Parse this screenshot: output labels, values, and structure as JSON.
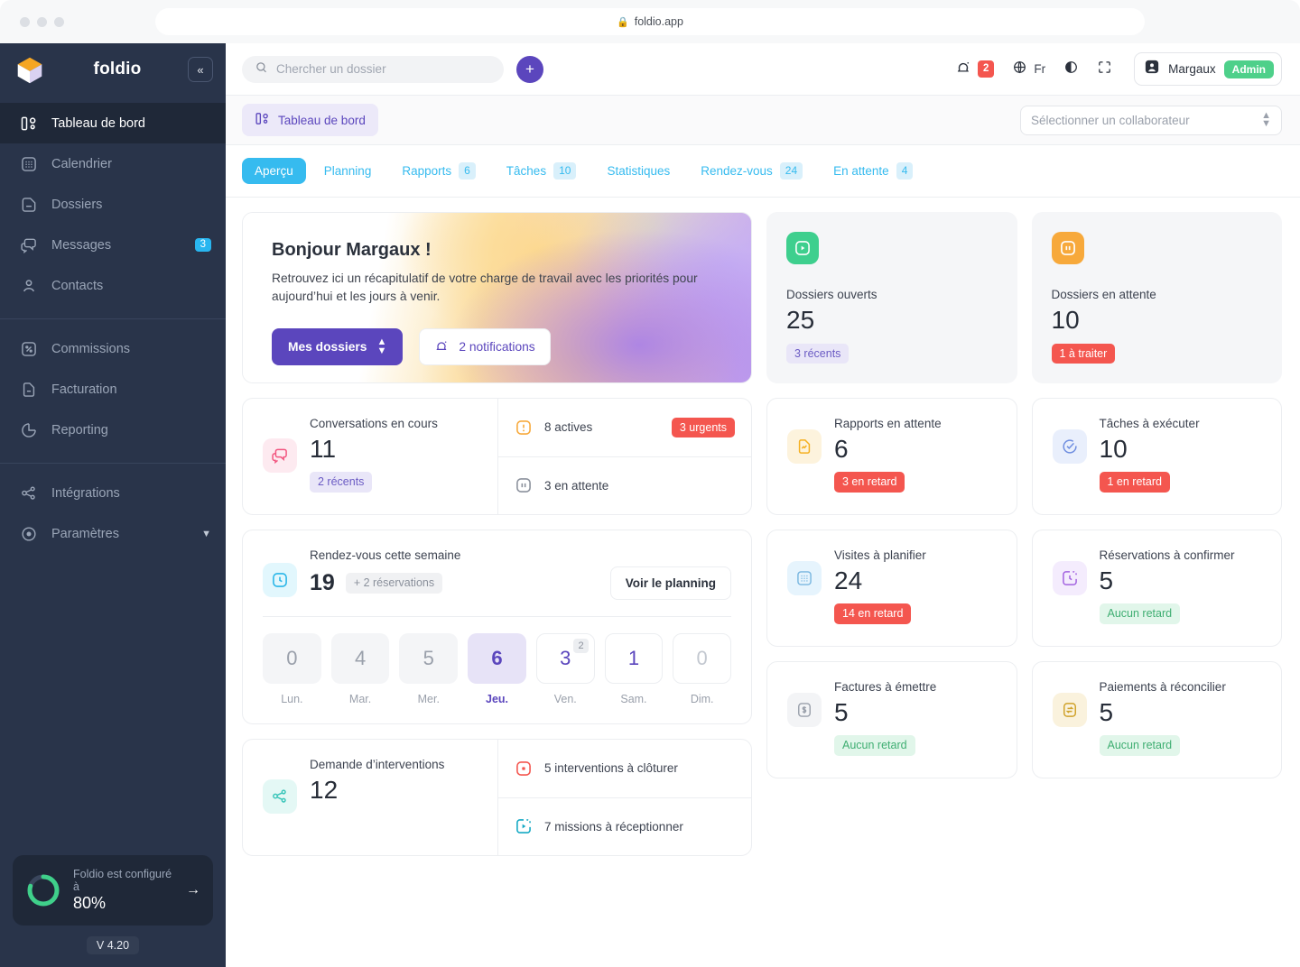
{
  "browser": {
    "url": "foldio.app",
    "lock_icon": "lock-icon"
  },
  "sidebar": {
    "brand": "foldio",
    "collapse_icon": "«",
    "items": [
      {
        "label": "Tableau de bord",
        "icon": "dashboard-icon",
        "active": true
      },
      {
        "label": "Calendrier",
        "icon": "calendar-icon"
      },
      {
        "label": "Dossiers",
        "icon": "folder-icon"
      },
      {
        "label": "Messages",
        "icon": "messages-icon",
        "badge": "3"
      },
      {
        "label": "Contacts",
        "icon": "user-icon"
      }
    ],
    "items2": [
      {
        "label": "Commissions",
        "icon": "percent-icon"
      },
      {
        "label": "Facturation",
        "icon": "invoice-icon"
      },
      {
        "label": "Reporting",
        "icon": "pie-chart-icon"
      }
    ],
    "items3": [
      {
        "label": "Intégrations",
        "icon": "share-nodes-icon"
      },
      {
        "label": "Paramètres",
        "icon": "target-icon",
        "chevron": "chevron-down-icon"
      }
    ],
    "config": {
      "text": "Foldio est configuré à",
      "percent": "80%",
      "progress": 80,
      "arrow": "→"
    },
    "version": "V 4.20"
  },
  "topbar": {
    "search_placeholder": "Chercher un dossier",
    "search_value": "",
    "add_label": "+",
    "notifications_count": "2",
    "language": "Fr",
    "user_name": "Margaux",
    "user_role": "Admin"
  },
  "crumbbar": {
    "breadcrumb": "Tableau de bord",
    "collaborator_placeholder": "Sélectionner un collaborateur"
  },
  "tabs": [
    {
      "label": "Aperçu",
      "count": null,
      "active": true
    },
    {
      "label": "Planning",
      "count": null
    },
    {
      "label": "Rapports",
      "count": "6"
    },
    {
      "label": "Tâches",
      "count": "10"
    },
    {
      "label": "Statistiques",
      "count": null
    },
    {
      "label": "Rendez-vous",
      "count": "24"
    },
    {
      "label": "En attente",
      "count": "4"
    }
  ],
  "hero": {
    "title": "Bonjour Margaux !",
    "subtitle": "Retrouvez ici un récapitulatif de votre charge de travail avec les priorités pour aujourd’hui et les jours à venir.",
    "primary_button": "Mes dossiers",
    "secondary_button": "2 notifications"
  },
  "bigstats": [
    {
      "title": "Dossiers ouverts",
      "value": "25",
      "chip": "3 récents",
      "chip_style": "violet",
      "icon": "play-square-icon",
      "icon_bg": "#3ecf8e"
    },
    {
      "title": "Dossiers en attente",
      "value": "10",
      "chip": "1 à traiter",
      "chip_style": "red",
      "icon": "pause-square-icon",
      "icon_bg": "#f7a93b"
    }
  ],
  "conversations": {
    "title": "Conversations en cours",
    "value": "11",
    "chip": "2 récents",
    "icon": "chat-icon",
    "rows": [
      {
        "icon": "alert-square-icon",
        "text": "8 actives",
        "chip": "3 urgents"
      },
      {
        "icon": "pause-square-icon",
        "text": "3 en attente",
        "chip": null
      }
    ]
  },
  "ministats": [
    {
      "title": "Rapports en attente",
      "value": "6",
      "chip": "3 en retard",
      "chip_style": "red",
      "icon": "report-icon"
    },
    {
      "title": "Tâches à exécuter",
      "value": "10",
      "chip": "1 en retard",
      "chip_style": "red",
      "icon": "check-circle-icon"
    },
    {
      "title": "Visites à planifier",
      "value": "24",
      "chip": "14 en retard",
      "chip_style": "red",
      "icon": "calendar-grid-icon"
    },
    {
      "title": "Réservations à confirmer",
      "value": "5",
      "chip": "Aucun retard",
      "chip_style": "green",
      "icon": "timer-icon"
    },
    {
      "title": "Factures à émettre",
      "value": "5",
      "chip": "Aucun retard",
      "chip_style": "green",
      "icon": "money-icon"
    },
    {
      "title": "Paiements à réconcilier",
      "value": "5",
      "chip": "Aucun retard",
      "chip_style": "green",
      "icon": "transfer-icon"
    }
  ],
  "week": {
    "title": "Rendez-vous cette semaine",
    "value": "19",
    "chip": "+ 2 réservations",
    "button": "Voir le planning",
    "icon": "clock-icon",
    "days": [
      {
        "label": "Lun.",
        "value": "0",
        "style": "gray"
      },
      {
        "label": "Mar.",
        "value": "4",
        "style": "gray"
      },
      {
        "label": "Mer.",
        "value": "5",
        "style": "gray"
      },
      {
        "label": "Jeu.",
        "value": "6",
        "style": "selected"
      },
      {
        "label": "Ven.",
        "value": "3",
        "style": "outline",
        "mini": "2"
      },
      {
        "label": "Sam.",
        "value": "1",
        "style": "outline"
      },
      {
        "label": "Dim.",
        "value": "0",
        "style": "outline-zero"
      }
    ]
  },
  "interventions": {
    "title": "Demande d’interventions",
    "value": "12",
    "icon": "share-nodes-icon",
    "rows": [
      {
        "icon": "stop-square-icon",
        "text": "5 interventions à clôturer"
      },
      {
        "icon": "play-dashed-icon",
        "text": "7 missions à réceptionner"
      }
    ]
  },
  "colors": {
    "brand_purple": "#5b46bd",
    "tab_cyan": "#36bbef",
    "danger_red": "#f4564f",
    "success_green": "#4ed08a",
    "sidebar_bg": "#29344a"
  }
}
